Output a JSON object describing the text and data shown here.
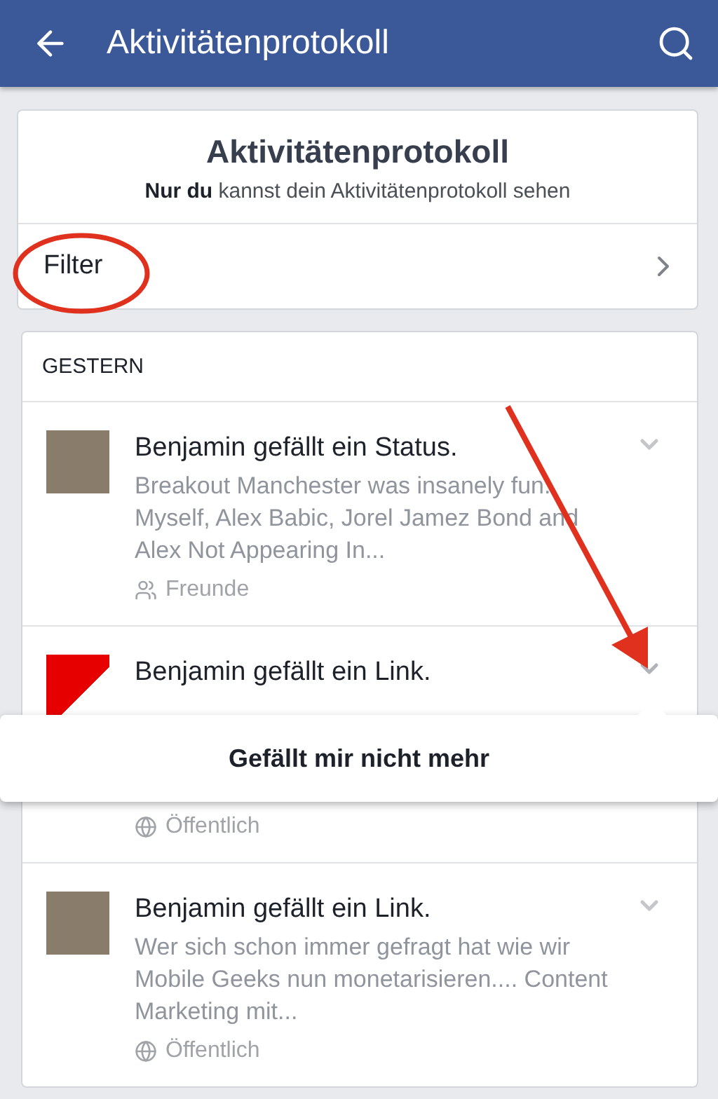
{
  "app_bar": {
    "title": "Aktivitätenprotokoll"
  },
  "intro": {
    "title": "Aktivitätenprotokoll",
    "subtitle": "**Nur du** kannst dein Aktivitätenprotokoll sehen",
    "filter": "Filter"
  },
  "section": {
    "heading": "GESTERN",
    "items": [
      {
        "title": "Benjamin gefällt ein Status.",
        "thumbnail": {
          "kind": "photo"
        },
        "body": "Breakout Manchester was insanely fun. Myself, Alex Babic, Jorel Jamez Bond and Alex Not Appearing In...",
        "audience": {
          "kind": "friends",
          "label": "Freunde"
        },
        "menu_open": false
      },
      {
        "title": "Benjamin gefällt ein Link.",
        "thumbnail": {
          "kind": "logo"
        },
        "audience": {
          "kind": "public",
          "label": "Öffentlich"
        },
        "menu_open": true
      },
      {
        "title": "Benjamin gefällt ein Link.",
        "thumbnail": {
          "kind": "photo"
        },
        "body": "Wer sich schon immer gefragt hat wie wir Mobile Geeks nun monetarisieren.... Content Marketing mit...",
        "audience": {
          "kind": "public",
          "label": "Öffentlich"
        },
        "menu_open": false
      }
    ]
  },
  "popup_menu": {
    "items": [
      "Gefällt mir nicht mehr"
    ]
  }
}
